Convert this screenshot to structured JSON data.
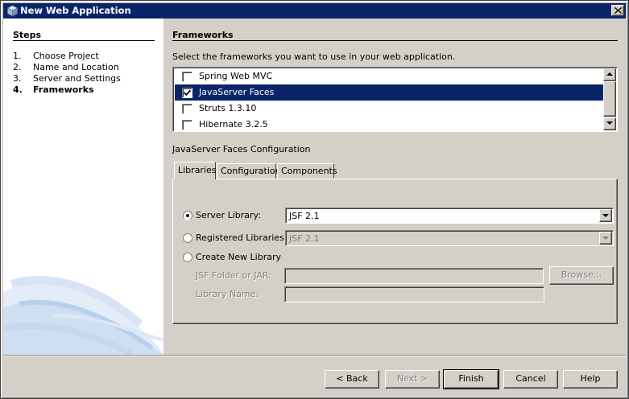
{
  "window": {
    "title": "New Web Application",
    "icon": "cube-icon",
    "title_bg": "#0a246a"
  },
  "steps": {
    "title": "Steps",
    "items": [
      {
        "num": "1.",
        "label": "Choose Project",
        "current": false
      },
      {
        "num": "2.",
        "label": "Name and Location",
        "current": false
      },
      {
        "num": "3.",
        "label": "Server and Settings",
        "current": false
      },
      {
        "num": "4.",
        "label": "Frameworks",
        "current": true
      }
    ]
  },
  "frameworks": {
    "title": "Frameworks",
    "instruction": "Select the frameworks you want to use in your web application.",
    "items": [
      {
        "label": "Spring Web MVC",
        "checked": false,
        "selected": false
      },
      {
        "label": "JavaServer Faces",
        "checked": true,
        "selected": true
      },
      {
        "label": "Struts 1.3.10",
        "checked": false,
        "selected": false
      },
      {
        "label": "Hibernate 3.2.5",
        "checked": false,
        "selected": false
      }
    ],
    "selection_color": "#0a246a"
  },
  "config": {
    "title": "JavaServer Faces Configuration",
    "tabs": [
      {
        "label": "Libraries",
        "active": true
      },
      {
        "label": "Configuration",
        "active": false
      },
      {
        "label": "Components",
        "active": false
      }
    ],
    "server_library": {
      "label": "Server Library:",
      "value": "JSF 2.1",
      "selected": true
    },
    "registered_libraries": {
      "label": "Registered Libraries:",
      "value": "JSF 2.1",
      "selected": false
    },
    "create_new_library": {
      "label": "Create New Library",
      "selected": false
    },
    "jsf_folder": {
      "label": "JSF Folder or JAR:",
      "value": ""
    },
    "library_name": {
      "label": "Library Name:",
      "value": ""
    },
    "browse_label": "Browse..."
  },
  "buttons": {
    "back": "< Back",
    "next": "Next >",
    "finish": "Finish",
    "cancel": "Cancel",
    "help": "Help"
  }
}
